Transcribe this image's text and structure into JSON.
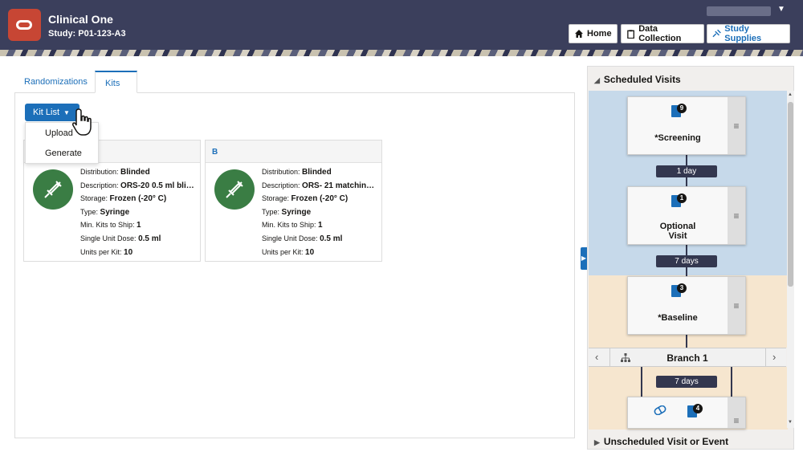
{
  "header": {
    "app_title": "Clinical One",
    "study": "Study: P01-123-A3",
    "nav": [
      {
        "label": "Home"
      },
      {
        "label": "Data Collection"
      },
      {
        "label": "Study Supplies"
      }
    ]
  },
  "tabs": [
    {
      "label": "Randomizations"
    },
    {
      "label": "Kits"
    }
  ],
  "kit_list": {
    "button_label": "Kit List",
    "menu": [
      "Upload",
      "Generate"
    ]
  },
  "kits": [
    {
      "name": "",
      "distribution_label": "Distribution:",
      "distribution": "Blinded",
      "description_label": "Description:",
      "description": "ORS-20 0.5 ml bli…",
      "storage_label": "Storage:",
      "storage": "Frozen (-20° C)",
      "type_label": "Type:",
      "type": "Syringe",
      "min_kits_label": "Min. Kits to Ship:",
      "min_kits": "1",
      "dose_label": "Single Unit Dose:",
      "dose": "0.5 ml",
      "units_label": "Units per Kit:",
      "units": "10"
    },
    {
      "name": "B",
      "distribution_label": "Distribution:",
      "distribution": "Blinded",
      "description_label": "Description:",
      "description": "ORS- 21 matchin…",
      "storage_label": "Storage:",
      "storage": "Frozen (-20° C)",
      "type_label": "Type:",
      "type": "Syringe",
      "min_kits_label": "Min. Kits to Ship:",
      "min_kits": "1",
      "dose_label": "Single Unit Dose:",
      "dose": "0.5 ml",
      "units_label": "Units per Kit:",
      "units": "10"
    }
  ],
  "scheduled_visits": {
    "title": "Scheduled Visits",
    "visits": [
      {
        "name": "*Screening",
        "badge": "9"
      },
      {
        "name": "Optional\nVisit",
        "badge": "1"
      },
      {
        "name": "*Baseline",
        "badge": "3"
      },
      {
        "name": "",
        "badge": "4"
      }
    ],
    "intervals": [
      "1 day",
      "7 days",
      "7 days"
    ],
    "branch_label": "Branch 1",
    "unscheduled_title": "Unscheduled Visit or Event"
  },
  "colors": {
    "header_bg": "#3b3f5c",
    "accent": "#1c6fb9",
    "kit_icon": "#3a7d44",
    "logo": "#c74634"
  }
}
